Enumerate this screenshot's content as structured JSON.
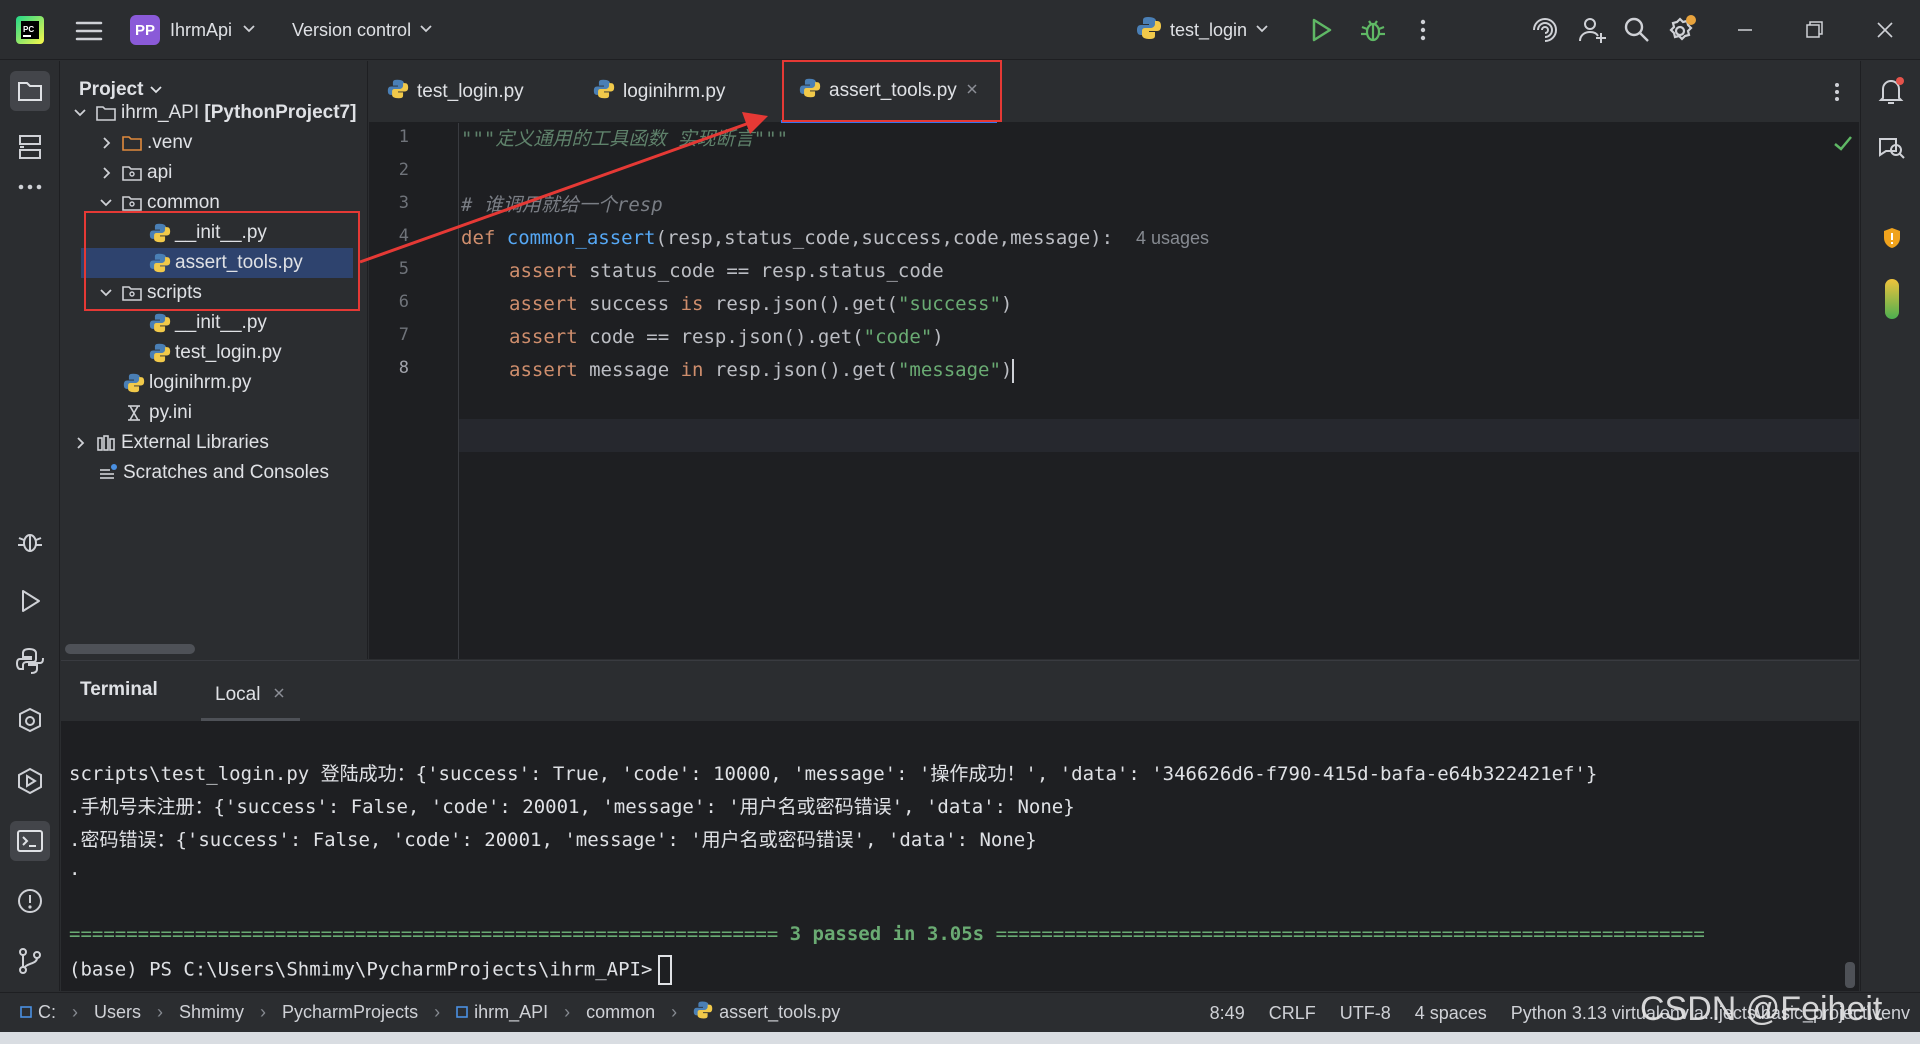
{
  "titlebar": {
    "project_badge": "PP",
    "project_name": "IhrmApi",
    "vcs_label": "Version control",
    "run_config": "test_login"
  },
  "project_panel": {
    "title": "Project",
    "tree": [
      {
        "name": "ihrm_API",
        "suffix": "[PythonProject7]",
        "kind": "root-folder",
        "expanded": true
      },
      {
        "name": ".venv",
        "kind": "venv-folder",
        "expanded": false
      },
      {
        "name": "api",
        "kind": "package",
        "expanded": false
      },
      {
        "name": "common",
        "kind": "package",
        "expanded": true
      },
      {
        "name": "__init__.py",
        "kind": "python-file"
      },
      {
        "name": "assert_tools.py",
        "kind": "python-file",
        "selected": true
      },
      {
        "name": "scripts",
        "kind": "package",
        "expanded": true
      },
      {
        "name": "__init__.py",
        "kind": "python-file"
      },
      {
        "name": "test_login.py",
        "kind": "python-file"
      },
      {
        "name": "loginihrm.py",
        "kind": "python-file"
      },
      {
        "name": "py.ini",
        "kind": "ini-file"
      },
      {
        "name": "External Libraries",
        "kind": "library",
        "expanded": false
      },
      {
        "name": "Scratches and Consoles",
        "kind": "scratches"
      }
    ]
  },
  "editor": {
    "tabs": [
      {
        "label": "test_login.py",
        "active": false
      },
      {
        "label": "loginihrm.py",
        "active": false
      },
      {
        "label": "assert_tools.py",
        "active": true
      }
    ],
    "line_numbers": [
      "1",
      "2",
      "3",
      "4",
      "5",
      "6",
      "7",
      "8"
    ],
    "current_line": "8",
    "code": {
      "l1_doc": "\"\"\"定义通用的工具函数 实现断言\"\"\"",
      "l3_comment": "# 谁调用就给一个resp",
      "l4_kw": "def",
      "l4_fn": "common_assert",
      "l4_params": "(resp,status_code,success,code,message):",
      "l4_hint": "4 usages",
      "l5_kw": "assert",
      "l5_rest": " status_code == resp.status_code",
      "l6_kw": "assert",
      "l6_a": " success ",
      "l6_kw2": "is",
      "l6_b": " resp.json().get(",
      "l6_str": "\"success\"",
      "l6_c": ")",
      "l7_kw": "assert",
      "l7_a": " code == resp.json().get(",
      "l7_str": "\"code\"",
      "l7_c": ")",
      "l8_kw": "assert",
      "l8_a": " message ",
      "l8_kw2": "in",
      "l8_b": " resp.json().get(",
      "l8_str": "\"message\"",
      "l8_c": ")"
    }
  },
  "terminal": {
    "title": "Terminal",
    "tab_label": "Local",
    "lines": [
      "scripts\\test_login.py 登陆成功：{'success': True, 'code': 10000, 'message': '操作成功！', 'data': '346626d6-f790-415d-bafa-e64b322421ef'}",
      ".手机号未注册：{'success': False, 'code': 20001, 'message': '用户名或密码错误', 'data': None}",
      ".密码错误：{'success': False, 'code': 20001, 'message': '用户名或密码错误', 'data': None}",
      "."
    ],
    "result_left": "==============================================================",
    "result_text": " 3 passed in 3.05s ",
    "result_right": "==============================================================",
    "prompt": "(base) PS C:\\Users\\Shmimy\\PycharmProjects\\ihrm_API>"
  },
  "statusbar": {
    "breadcrumbs": [
      "C:",
      "Users",
      "Shmimy",
      "PycharmProjects",
      "ihrm_API",
      "common",
      "assert_tools.py"
    ],
    "position": "8:49",
    "line_sep": "CRLF",
    "encoding": "UTF-8",
    "indent": "4 spaces",
    "interpreter": "Python 3.13 virtualenv a...jects\\basic_project\\venv"
  },
  "watermark": "CSDN @Feiheit",
  "colors": {
    "bg": "#2b2d30",
    "editor_bg": "#1e1f22",
    "accent": "#3574f0",
    "keyword": "#cf8e6d",
    "function": "#56a8f5",
    "string": "#6aab73",
    "annotation_red": "#e53935"
  },
  "icons": [
    "pycharm-logo",
    "hamburger-menu-icon",
    "chevron-down-icon",
    "python-icon",
    "run-icon",
    "debug-icon",
    "more-vert-icon",
    "ai-assistant-icon",
    "add-user-icon",
    "search-icon",
    "settings-icon",
    "minimize-icon",
    "restore-icon",
    "close-icon",
    "folder-icon",
    "structure-icon",
    "more-horiz-icon",
    "bug-icon",
    "play-icon",
    "python-console-icon",
    "services-icon",
    "run-services-icon",
    "terminal-icon",
    "problems-icon",
    "git-icon",
    "notifications-icon",
    "ai-chat-icon",
    "check-icon"
  ]
}
